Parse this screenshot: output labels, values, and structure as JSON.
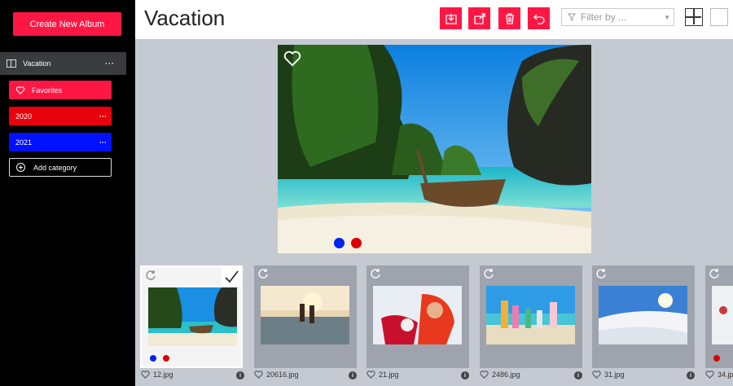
{
  "sidebar": {
    "create_button": "Create New Album",
    "album": {
      "name": "Vacation",
      "more": "···"
    },
    "categories": [
      {
        "label": "Favorites",
        "color": "#ff1744"
      },
      {
        "label": "2020",
        "color": "#e8000d",
        "more": "···"
      },
      {
        "label": "2021",
        "color": "#0011ff",
        "more": "···"
      }
    ],
    "add_category": "Add category"
  },
  "header": {
    "title": "Vacation",
    "filter_placeholder": "Filter by ...",
    "tools": [
      "import-icon",
      "export-icon",
      "trash-icon",
      "undo-icon"
    ],
    "accent": "#ff1744"
  },
  "main_photo": {
    "tags": [
      "#0022ee",
      "#dd0000"
    ]
  },
  "thumbnails": [
    {
      "file": "12.jpg",
      "selected": true,
      "tags": [
        "#0022ee",
        "#dd0000"
      ]
    },
    {
      "file": "20616.jpg",
      "selected": false,
      "tags": []
    },
    {
      "file": "21.jpg",
      "selected": false,
      "tags": []
    },
    {
      "file": "2486.jpg",
      "selected": false,
      "tags": []
    },
    {
      "file": "31.jpg",
      "selected": false,
      "tags": []
    },
    {
      "file": "34.jp",
      "selected": false,
      "tags": [
        "#dd0000"
      ]
    }
  ]
}
